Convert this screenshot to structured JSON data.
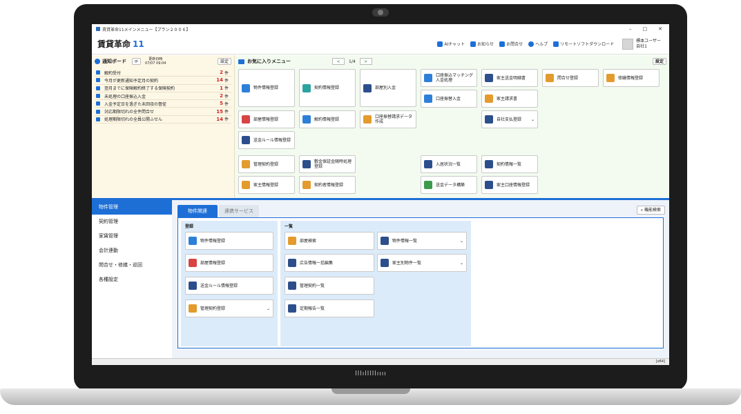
{
  "window": {
    "title": "賃貸革命11メインメニュー【プラン２００６】",
    "controls": [
      "–",
      "□",
      "✕"
    ]
  },
  "header": {
    "logo_text": "賃貸革命",
    "logo_num": "11",
    "links": [
      "AIチャット",
      "お知らせ",
      "お問合せ",
      "ヘルプ",
      "リモートソフトダウンロード"
    ],
    "user_name": "標本ユーザー",
    "user_company": "自社1"
  },
  "notify": {
    "title": "通知ボード",
    "update_label": "更新日時",
    "update_time": "07/07 09:04",
    "settings_label": "設定",
    "items": [
      {
        "label": "解約受付",
        "count": "2",
        "unit": "件"
      },
      {
        "label": "今月が更新通知予定月の契約",
        "count": "14",
        "unit": "件"
      },
      {
        "label": "翌月までに保険解約終了する保険契約",
        "count": "1",
        "unit": "件"
      },
      {
        "label": "未処理の口座振込入金",
        "count": "2",
        "unit": "件"
      },
      {
        "label": "入金予定日を過ぎた未回収の督促",
        "count": "5",
        "unit": "件"
      },
      {
        "label": "対応期限切れの全件問合せ",
        "count": "15",
        "unit": "件"
      },
      {
        "label": "処理期限切れの全員公開ふせん",
        "count": "14",
        "unit": "件"
      }
    ]
  },
  "favorites": {
    "title": "お気に入りメニュー",
    "page": "1/4",
    "prev": "<",
    "next": ">",
    "settings_label": "設定",
    "tiles": [
      "物件情報登録",
      "契約情報登録",
      "部屋別入金",
      "口座振込マッチング入金処理",
      "家主送金明細書",
      "問合せ登録",
      "修繕情報登録",
      "口座振替入金",
      "家主請求書",
      "部屋情報登録",
      "解約情報登録",
      "口座振替請求データ作成",
      "自社支払登録",
      "送金ルール情報登録",
      "管理契約登録",
      "敷金保証金随時処理登録",
      "入居状況一覧",
      "契約情報一覧",
      "家主情報登録",
      "契約者情報登録",
      "送金データ構築",
      "家主口座情報登録"
    ]
  },
  "sidebar": {
    "items": [
      "物件管理",
      "契約管理",
      "家賃管理",
      "会計連動",
      "問合せ・修繕・巡回",
      "各種設定"
    ]
  },
  "tabs": [
    "物件関連",
    "連携サービス"
  ],
  "detail_search": "機能検索",
  "groups": {
    "register": {
      "title": "登録",
      "items": [
        "物件情報登録",
        "部屋情報登録",
        "送金ルール情報登録",
        "管理契約登録"
      ]
    },
    "list": {
      "title": "一覧",
      "items": [
        "部屋検索",
        "広告情報一括編集",
        "管理契約一覧",
        "定期報告一覧",
        "物件情報一覧",
        "家主別物件一覧"
      ]
    }
  },
  "status": "[x64]",
  "brand_label": "lllılllllıııı",
  "colors": {
    "accent": "#1d6fd6",
    "count_red": "#d21d1d",
    "notify_bg": "#fdf7e6",
    "fav_bg": "#f3fbf0"
  }
}
